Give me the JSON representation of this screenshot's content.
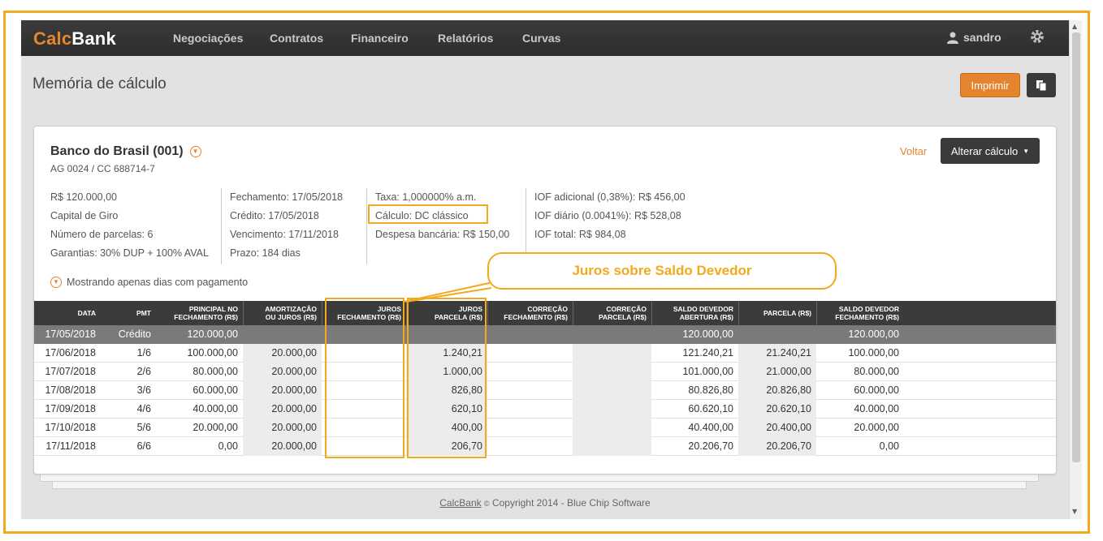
{
  "app": {
    "brand_prefix": "Calc",
    "brand_suffix": "Bank",
    "nav": [
      "Negociações",
      "Contratos",
      "Financeiro",
      "Relatórios",
      "Curvas"
    ],
    "user": "sandro"
  },
  "page": {
    "title": "Memória de cálculo",
    "print_label": "Imprimir"
  },
  "card": {
    "bank_name": "Banco do Brasil (001)",
    "account": "AG 0024 / CC 688714-7",
    "back_label": "Voltar",
    "alter_label": "Alterar cálculo",
    "col1": [
      "R$ 120.000,00",
      "Capital de Giro",
      "Número de parcelas: 6",
      "Garantias: 30% DUP + 100% AVAL"
    ],
    "col2": [
      "Fechamento: 17/05/2018",
      "Crédito: 17/05/2018",
      "Vencimento: 17/11/2018",
      "Prazo: 184 dias"
    ],
    "col3": [
      "Taxa: 1,000000% a.m.",
      "Cálculo: DC clássico",
      "Despesa bancária: R$ 150,00"
    ],
    "col4": [
      "IOF adicional (0,38%): R$ 456,00",
      "IOF diário (0.0041%): R$ 528,08",
      "IOF total: R$ 984,08"
    ],
    "filter_label": "Mostrando apenas dias com pagamento"
  },
  "callout": "Juros sobre Saldo Devedor",
  "table": {
    "headers": [
      [
        "DATA"
      ],
      [
        "PMT"
      ],
      [
        "PRINCIPAL NO",
        "FECHAMENTO (R$)"
      ],
      [
        "AMORTIZAÇÃO",
        "OU JUROS (R$)"
      ],
      [
        "JUROS",
        "FECHAMENTO (R$)"
      ],
      [
        "JUROS",
        "PARCELA (R$)"
      ],
      [
        "CORREÇÃO",
        "FECHAMENTO (R$)"
      ],
      [
        "CORREÇÃO",
        "PARCELA (R$)"
      ],
      [
        "SALDO DEVEDOR",
        "ABERTURA (R$)"
      ],
      [
        "PARCELA (R$)"
      ],
      [
        "SALDO DEVEDOR",
        "FECHAMENTO (R$)"
      ]
    ],
    "rows": [
      [
        "17/05/2018",
        "Crédito",
        "120.000,00",
        "",
        "",
        "",
        "",
        "",
        "120.000,00",
        "",
        "120.000,00"
      ],
      [
        "17/06/2018",
        "1/6",
        "100.000,00",
        "20.000,00",
        "",
        "1.240,21",
        "",
        "",
        "121.240,21",
        "21.240,21",
        "100.000,00"
      ],
      [
        "17/07/2018",
        "2/6",
        "80.000,00",
        "20.000,00",
        "",
        "1.000,00",
        "",
        "",
        "101.000,00",
        "21.000,00",
        "80.000,00"
      ],
      [
        "17/08/2018",
        "3/6",
        "60.000,00",
        "20.000,00",
        "",
        "826,80",
        "",
        "",
        "80.826,80",
        "20.826,80",
        "60.000,00"
      ],
      [
        "17/09/2018",
        "4/6",
        "40.000,00",
        "20.000,00",
        "",
        "620,10",
        "",
        "",
        "60.620,10",
        "20.620,10",
        "40.000,00"
      ],
      [
        "17/10/2018",
        "5/6",
        "20.000,00",
        "20.000,00",
        "",
        "400,00",
        "",
        "",
        "40.400,00",
        "20.400,00",
        "20.000,00"
      ],
      [
        "17/11/2018",
        "6/6",
        "0,00",
        "20.000,00",
        "",
        "206,70",
        "",
        "",
        "20.206,70",
        "20.206,70",
        "0,00"
      ]
    ]
  },
  "footer": {
    "link": "CalcBank",
    "copyright_symbol": "©",
    "text": "Copyright 2014 - Blue Chip Software"
  },
  "colors": {
    "accent": "#e6832f",
    "highlight": "#f2a91c",
    "navbar": "#2d2d2d"
  },
  "icons": {
    "user": "user-icon",
    "settings": "gear-icon",
    "copy": "copy-icon",
    "chevron": "chevron-down-icon"
  }
}
